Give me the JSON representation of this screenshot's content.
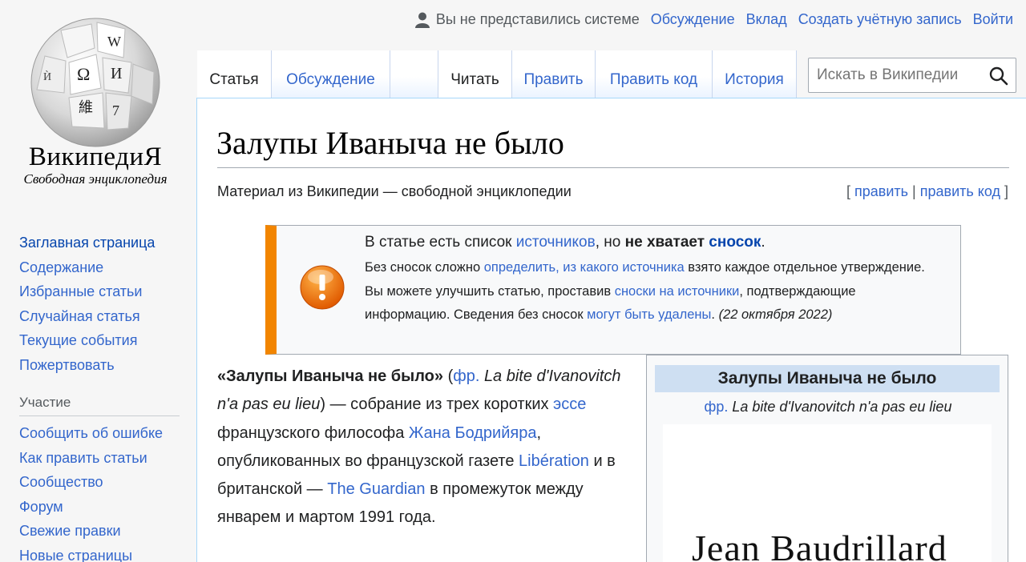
{
  "logo": {
    "wordmark": "ВикипедиЯ",
    "tagline": "Свободная энциклопедия",
    "globe_glyphs": [
      "Ω",
      "W",
      "И",
      "維",
      "Ѝ",
      "7"
    ]
  },
  "sidebar": {
    "main": [
      "Заглавная страница",
      "Содержание",
      "Избранные статьи",
      "Случайная статья",
      "Текущие события",
      "Пожертвовать"
    ],
    "heading": "Участие",
    "participation": [
      "Сообщить об ошибке",
      "Как править статьи",
      "Сообщество",
      "Форум",
      "Свежие правки",
      "Новые страницы"
    ]
  },
  "personal": {
    "status": "Вы не представились системе",
    "talk": "Обсуждение",
    "contrib": "Вклад",
    "create": "Создать учётную запись",
    "login": "Войти"
  },
  "tabs": {
    "article": "Статья",
    "discussion": "Обсуждение",
    "read": "Читать",
    "edit": "Править",
    "edit_source": "Править код",
    "history": "История"
  },
  "search": {
    "placeholder": "Искать в Википедии"
  },
  "page": {
    "title": "Залупы Иваныча не было",
    "subtitle": "Материал из Википедии — свободной энциклопедии",
    "edit_open": "[",
    "edit": "править",
    "edit_sep": "|",
    "edit_source": "править код",
    "edit_close": "]"
  },
  "ambox": {
    "p1": "В статье есть список ",
    "l1": "источников",
    "p2": ", но ",
    "b1": "не хватает ",
    "l2": "сносок",
    "p3": ".",
    "s1": "Без сносок сложно ",
    "sl1": "определить, из какого источника",
    "s2": " взято каждое отдельное утверждение. Вы можете улучшить статью, проставив ",
    "sl2": "сноски на источники",
    "s3": ", подтверждающие информацию. Сведения без сносок ",
    "sl3": "могут быть удалены",
    "s4": ". ",
    "date": "(22 октября 2022)"
  },
  "article": {
    "bold": "«Залупы Иваныча не было»",
    "t1": " (",
    "fr": "фр.",
    "t2": " ",
    "orig": "La bite d'Ivanovitch n'a pas eu lieu",
    "t3": ") — собрание из трех коротких ",
    "essay": "эссе",
    "t4": " французского философа ",
    "author": "Жана Бодрийяра",
    "t5": ", опубликованных во французской газете ",
    "lib": "Libération",
    "t6": " и в британской — ",
    "guardian": "The Guardian",
    "t7": " в промежуток между январем и мартом 1991 года."
  },
  "infobox": {
    "title": "Залупы Иваныча не было",
    "fr": "фр.",
    "orig": "La bite d'Ivanovitch n'a pas eu lieu",
    "cover_text": "Jean Baudrillard"
  }
}
